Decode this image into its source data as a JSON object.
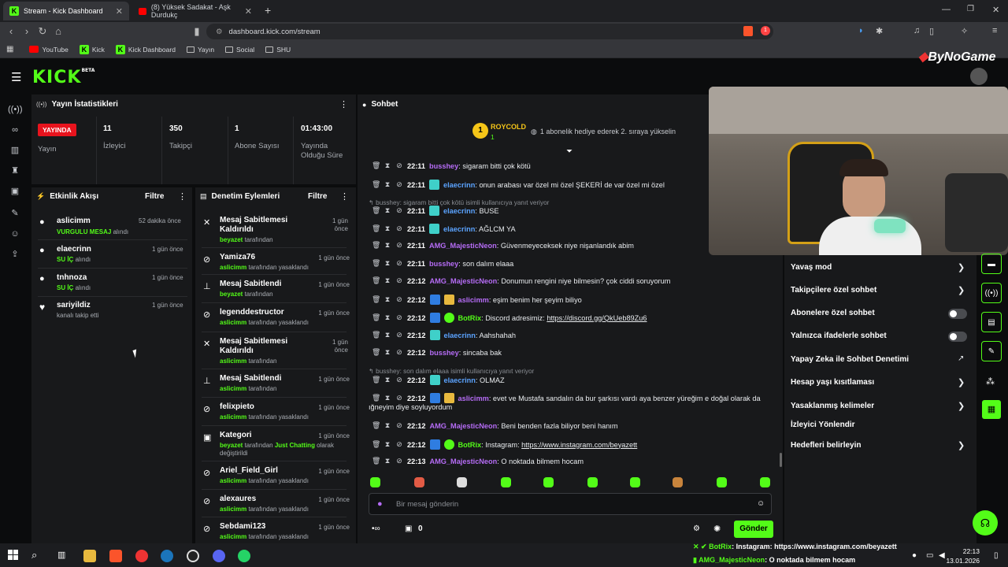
{
  "browser": {
    "tabs": [
      {
        "title": "Stream - Kick Dashboard",
        "active": true
      },
      {
        "title": "(8) Yüksek Sadakat - Aşk Durdukç",
        "active": false
      }
    ],
    "url": "dashboard.kick.com/stream",
    "bookmarks": [
      "YouTube",
      "Kick",
      "Kick Dashboard",
      "Yayın",
      "Social",
      "SHU"
    ],
    "extensions_badge": "1"
  },
  "header": {
    "logo": "KICK",
    "logo_tag": "BETA",
    "watermark": "ByNoGame"
  },
  "stats": {
    "title": "Yayın İstatistikleri",
    "live_badge": "YAYINDA",
    "live_label": "Yayın",
    "items": [
      {
        "value": "11",
        "label": "İzleyici"
      },
      {
        "value": "350",
        "label": "Takipçi"
      },
      {
        "value": "1",
        "label": "Abone Sayısı"
      },
      {
        "value": "01:43:00",
        "label": "Yayında Olduğu Süre"
      }
    ]
  },
  "activity": {
    "title": "Etkinlik Akışı",
    "filter": "Filtre",
    "items": [
      {
        "name": "aslicimm",
        "time": "52 dakika önce",
        "highlight": "VURGULU MESAJ",
        "rest": " alındı"
      },
      {
        "name": "elaecrinn",
        "time": "1 gün önce",
        "highlight": "SU İÇ",
        "rest": " alındı"
      },
      {
        "name": "tnhnoza",
        "time": "1 gün önce",
        "highlight": "SU İÇ",
        "rest": " alındı"
      },
      {
        "name": "sariyildiz",
        "time": "1 gün önce",
        "highlight": "",
        "rest": "kanalı takip etti"
      }
    ]
  },
  "moderation": {
    "title": "Denetim Eylemleri",
    "filter": "Filtre",
    "items": [
      {
        "title": "Mesaj Sabitlemesi Kaldırıldı",
        "user": "beyazet",
        "rest": " tarafından",
        "time": "1 gün önce"
      },
      {
        "title": "Yamiza76",
        "user": "aslicimm",
        "rest": " tarafından yasaklandı",
        "time": "1 gün önce"
      },
      {
        "title": "Mesaj Sabitlendi",
        "user": "beyazet",
        "rest": " tarafından",
        "time": "1 gün önce"
      },
      {
        "title": "legenddestructor",
        "user": "aslicimm",
        "rest": " tarafından yasaklandı",
        "time": "1 gün önce"
      },
      {
        "title": "Mesaj Sabitlemesi Kaldırıldı",
        "user": "aslicimm",
        "rest": " tarafından",
        "time": "1 gün önce"
      },
      {
        "title": "Mesaj Sabitlendi",
        "user": "aslicimm",
        "rest": " tarafından",
        "time": "1 gün önce"
      },
      {
        "title": "felixpieto",
        "user": "aslicimm",
        "rest": " tarafından yasaklandı",
        "time": "1 gün önce"
      },
      {
        "title": "Kategori",
        "user": "beyazet",
        "rest": " tarafından ",
        "extra": "Just Chatting",
        "rest2": " olarak değiştirildi",
        "time": "1 gün önce"
      },
      {
        "title": "Ariel_Field_Girl",
        "user": "aslicimm",
        "rest": " tarafından yasaklandı",
        "time": "1 gün önce"
      },
      {
        "title": "alexaures",
        "user": "aslicimm",
        "rest": " tarafından yasaklandı",
        "time": "1 gün önce"
      },
      {
        "title": "Sebdami123",
        "user": "aslicimm",
        "rest": " tarafından yasaklandı",
        "time": "1 gün önce"
      }
    ]
  },
  "chat": {
    "title": "Sohbet",
    "top_gifter": {
      "name": "ROYCOLD",
      "count": "1"
    },
    "gift_hint": "1 abonelik hediye ederek 2. sıraya yükselin",
    "messages": [
      {
        "time": "22:11",
        "user": "busshey",
        "color": "#b56cf5",
        "text": ": sigaram bitti çok kötü"
      },
      {
        "time": "22:11",
        "user": "elaecrinn",
        "color": "#5ba3ff",
        "text": ": onun arabası var özel mi özel ŞEKERİ de var özel mi özel"
      },
      {
        "reply": "busshey: sigaram bitti çok kötü isimli kullanıcıya yanıt veriyor"
      },
      {
        "time": "22:11",
        "user": "elaecrinn",
        "color": "#5ba3ff",
        "text": ": BUSE"
      },
      {
        "time": "22:11",
        "user": "elaecrinn",
        "color": "#5ba3ff",
        "text": ": AĞLCM YA"
      },
      {
        "time": "22:11",
        "user": "AMG_MajesticNeon",
        "color": "#b56cf5",
        "text": ": Güvenmeyeceksek niye nişanlandık abim"
      },
      {
        "time": "22:11",
        "user": "busshey",
        "color": "#b56cf5",
        "text": ": son dalım elaaa"
      },
      {
        "time": "22:12",
        "user": "AMG_MajesticNeon",
        "color": "#b56cf5",
        "text": ": Donumun rengini niye bilmesin? çok ciddi soruyorum"
      },
      {
        "time": "22:12",
        "user": "aslicimm",
        "color": "#b56cf5",
        "text": ": eşim benim her şeyim biliyo"
      },
      {
        "time": "22:12",
        "user": "BotRix",
        "color": "#53fc18",
        "text": ": Discord adresimiz: ",
        "link": "https://discord.gg/QkUeb89Zu6"
      },
      {
        "time": "22:12",
        "user": "elaecrinn",
        "color": "#5ba3ff",
        "text": ": Aahshahah"
      },
      {
        "time": "22:12",
        "user": "busshey",
        "color": "#b56cf5",
        "text": ": sincaba bak"
      },
      {
        "reply": "busshey: son dalım elaaa isimli kullanıcıya yanıt veriyor"
      },
      {
        "time": "22:12",
        "user": "elaecrinn",
        "color": "#5ba3ff",
        "text": ": OLMAZ"
      },
      {
        "time": "22:12",
        "user": "aslicimm",
        "color": "#b56cf5",
        "text": ": evet ve Mustafa sandalın da bur şarkısı vardı aya benzer yüreğim e doğal olarak da",
        "text2": "ığneyim diye soyluyordum"
      },
      {
        "time": "22:12",
        "user": "AMG_MajesticNeon",
        "color": "#b56cf5",
        "text": ": Beni benden fazla biliyor beni hanım"
      },
      {
        "time": "22:12",
        "user": "BotRix",
        "color": "#53fc18",
        "text": ": Instagram: ",
        "link": "https://www.instagram.com/beyazett"
      },
      {
        "time": "22:13",
        "user": "AMG_MajesticNeon",
        "color": "#b56cf5",
        "text": ": O noktada bilmem hocam"
      }
    ],
    "input_placeholder": "Bir mesaj gönderin",
    "points": "0",
    "send": "Gönder"
  },
  "settings": {
    "items": [
      {
        "label": "Yavaş mod",
        "control": "chevron"
      },
      {
        "label": "Takipçilere özel sohbet",
        "control": "chevron"
      },
      {
        "label": "Abonelere özel sohbet",
        "control": "toggle"
      },
      {
        "label": "Yalnızca ifadelerle sohbet",
        "control": "toggle"
      },
      {
        "label": "Yapay Zeka ile Sohbet Denetimi",
        "control": "external"
      },
      {
        "label": "Hesap yaşı kısıtlaması",
        "control": "chevron"
      },
      {
        "label": "Yasaklanmış kelimeler",
        "control": "chevron"
      },
      {
        "label": "İzleyici Yönlendir",
        "control": "none"
      },
      {
        "label": "Hedefleri belirleyin",
        "control": "chevron"
      }
    ]
  },
  "ticker": [
    {
      "user": "BotRix",
      "text": ": Instagram: https://www.instagram.com/beyazett"
    },
    {
      "user": "AMG_MajesticNeon",
      "text": ": O noktada bilmem hocam"
    }
  ],
  "taskbar": {
    "time": "22:13",
    "date": "13.01.2026"
  }
}
